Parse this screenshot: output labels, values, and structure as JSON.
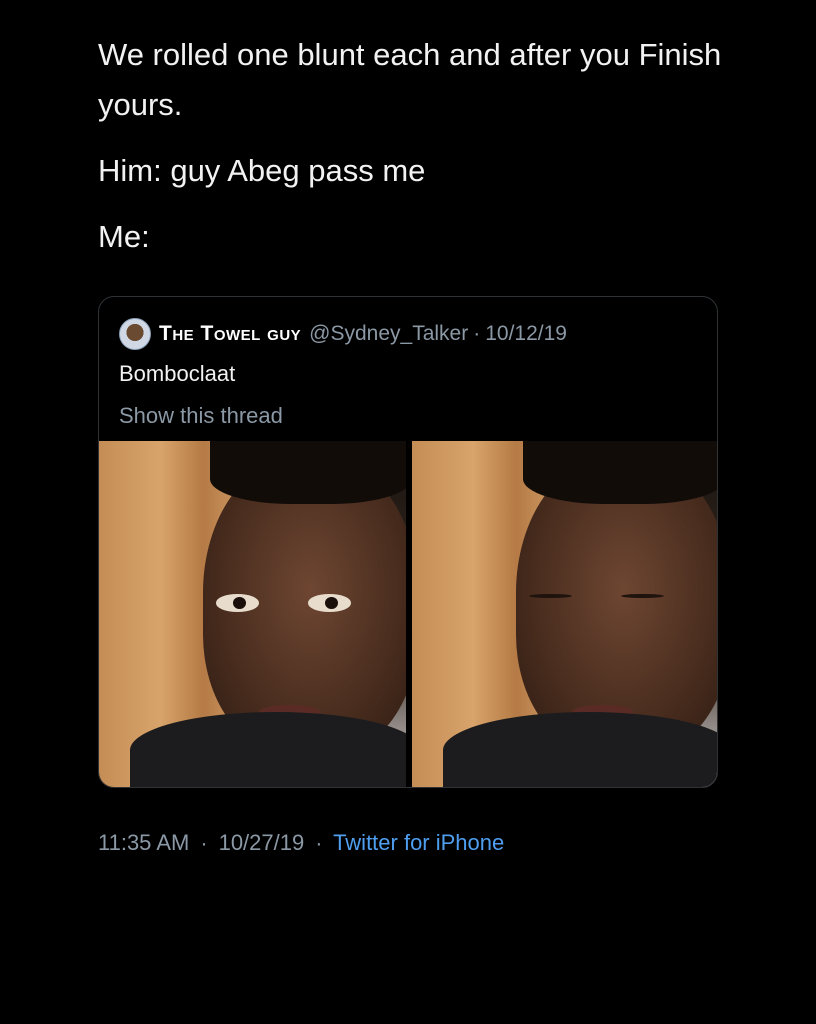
{
  "tweet": {
    "lines": [
      "We rolled one blunt each and after you Finish yours.",
      "Him: guy Abeg pass me",
      "Me:"
    ]
  },
  "quote": {
    "display_name": "The Towel guy",
    "handle": "@Sydney_Talker",
    "separator": "·",
    "date": "10/12/19",
    "text": "Bomboclaat",
    "show_thread": "Show this thread",
    "avatar_icon": "user-avatar"
  },
  "footer": {
    "time": "11:35 AM",
    "separator1": "·",
    "date": "10/27/19",
    "separator2": "·",
    "source": "Twitter for iPhone"
  },
  "colors": {
    "background": "#000000",
    "text": "#f2f2f2",
    "muted": "#8b98a5",
    "link": "#4f9ef0",
    "border": "#2f3336"
  }
}
